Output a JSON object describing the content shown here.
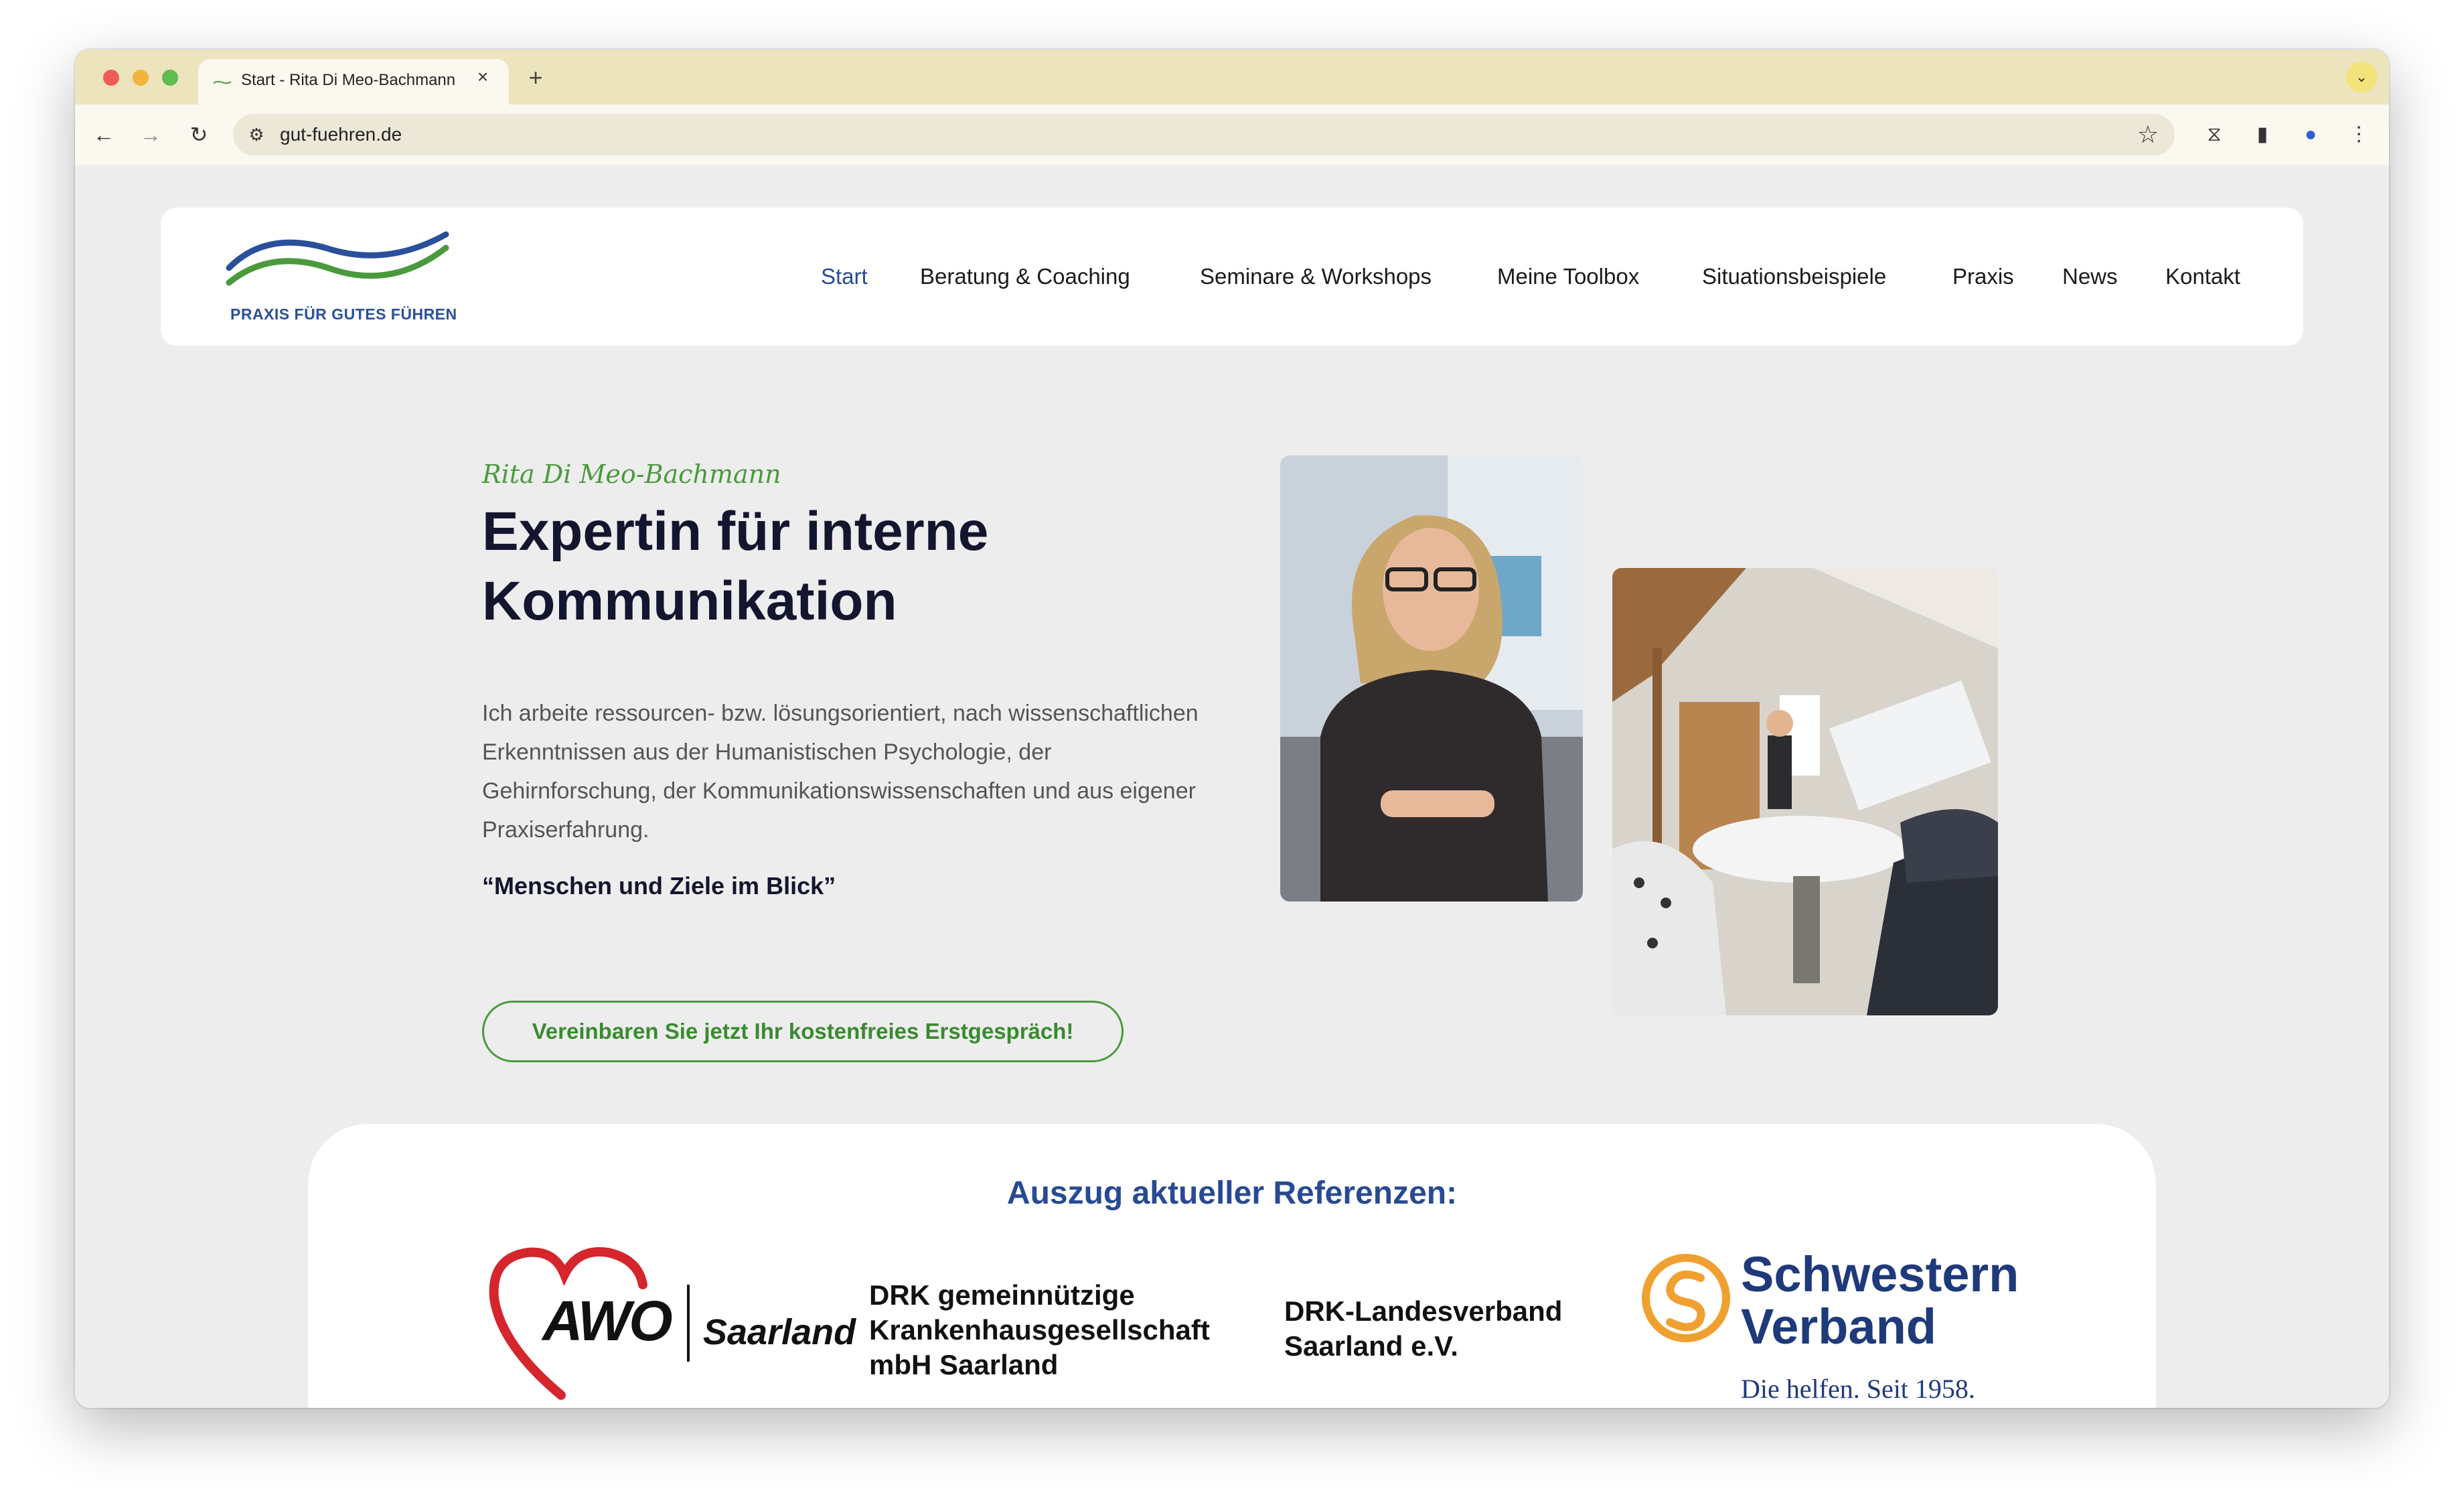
{
  "browser": {
    "tab_title": "Start - Rita Di Meo-Bachmann",
    "tab_close_icon": "×",
    "new_tab_icon": "+",
    "tab_menu_icon": "⌄",
    "url": "gut-fuehren.de",
    "icons": {
      "back": "←",
      "forward": "→",
      "reload": "↻",
      "site_info": "⚙",
      "bookmark": "☆",
      "extension": "⧖",
      "side_panel": "▮",
      "profile": "●",
      "menu": "⋮"
    }
  },
  "header": {
    "logo_text": "PRAXIS FÜR GUTES FÜHREN",
    "nav": [
      {
        "label": "Start",
        "active": true
      },
      {
        "label": "Beratung & Coaching"
      },
      {
        "label": "Seminare & Workshops"
      },
      {
        "label": "Meine Toolbox"
      },
      {
        "label": "Situationsbeispiele"
      },
      {
        "label": "Praxis"
      },
      {
        "label": "News"
      },
      {
        "label": "Kontakt"
      }
    ]
  },
  "hero": {
    "name": "Rita Di Meo-Bachmann",
    "title": "Expertin für interne Kommunikation",
    "text": "Ich arbeite ressourcen- bzw. lösungsorientiert, nach wissenschaftlichen Erkenntnissen aus der Humanistischen Psychologie, der Gehirnforschung, der Kommunikationswissenschaften und aus eigener Praxiserfahrung.",
    "quote": "“Menschen und Ziele im Blick”",
    "cta": "Vereinbaren Sie jetzt Ihr kostenfreies Erstgespräch!"
  },
  "references": {
    "title": "Auszug aktueller Referenzen:",
    "awo": {
      "left": "AWO",
      "right": "Saarland"
    },
    "drk_gem": [
      "DRK gemeinnützige",
      "Krankenhausgesellschaft",
      "mbH Saarland"
    ],
    "drk_lv": [
      "DRK-Landesverband",
      "Saarland e.V."
    ],
    "sv": {
      "line1": "Schwestern",
      "line2": "Verband",
      "tagline": "Die helfen. Seit 1958."
    }
  },
  "colors": {
    "accent_green": "#4a9a3d",
    "accent_blue": "#284a92",
    "page_bg": "#ededed",
    "tabbar_bg": "#ebe4bd"
  }
}
